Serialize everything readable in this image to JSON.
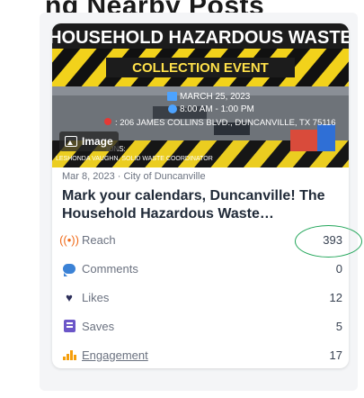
{
  "page": {
    "title_fragment": "ng Nearby Posts"
  },
  "post": {
    "image": {
      "banner_top": "HOUSEHOLD HAZARDOUS WASTE",
      "banner_sub": "COLLECTION EVENT",
      "date": "MARCH 25, 2023",
      "time": "8:00 AM - 1:00 PM",
      "address": ": 206 JAMES COLLINS BLVD., DUNCANVILLE, TX 75116",
      "caption_line1": "IONS:",
      "caption_line2": "LESHONDA VAUGHN, SOLID WASTE COORDINATOR",
      "badge_label": "Image"
    },
    "meta": "Mar 8, 2023 · City of Duncanville",
    "headline_line1": "Mark your calendars, Duncanville! The",
    "headline_line2": "Household Hazardous Waste…"
  },
  "stats": [
    {
      "label": "Reach",
      "value": "393",
      "icon": "broadcast-icon"
    },
    {
      "label": "Comments",
      "value": "0",
      "icon": "comment-icon"
    },
    {
      "label": "Likes",
      "value": "12",
      "icon": "heart-icon"
    },
    {
      "label": "Saves",
      "value": "5",
      "icon": "bookmark-icon"
    },
    {
      "label": "Engagement",
      "value": "17",
      "icon": "bar-chart-icon"
    }
  ],
  "colors": {
    "reach": "#f06b1a",
    "comment": "#3b82d6",
    "like": "#2d2f5a",
    "save": "#6b56c8",
    "engagement": "#f59e0b",
    "highlight": "#22a65a"
  }
}
